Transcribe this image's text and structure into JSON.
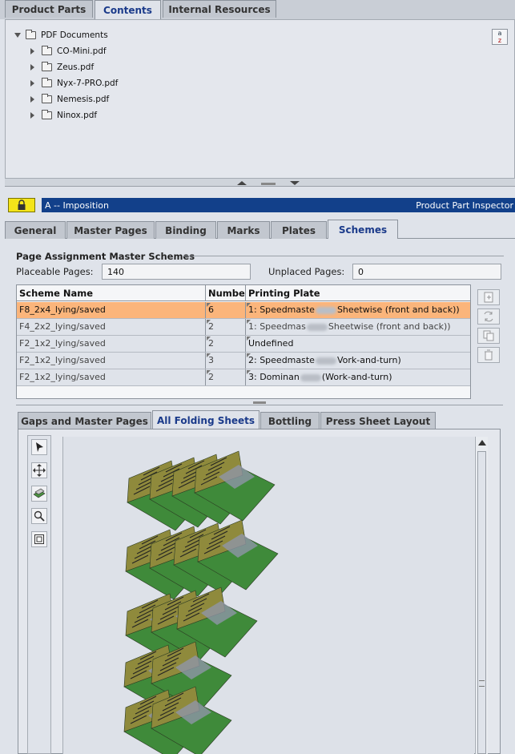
{
  "top_tabs": [
    {
      "label": "Product Parts",
      "active": false
    },
    {
      "label": "Contents",
      "active": true
    },
    {
      "label": "Internal Resources",
      "active": false
    }
  ],
  "tree": {
    "root": "PDF Documents",
    "items": [
      "CO-Mini.pdf",
      "Zeus.pdf",
      "Nyx-7-PRO.pdf",
      "Nemesis.pdf",
      "Ninox.pdf"
    ]
  },
  "sort_icon_text": {
    "top": "a",
    "bottom": "z"
  },
  "inspector": {
    "title": "A -- Imposition",
    "right_title": "Product Part Inspector"
  },
  "inspector_tabs": [
    {
      "label": "General",
      "active": false
    },
    {
      "label": "Master Pages",
      "active": false
    },
    {
      "label": "Binding",
      "active": false
    },
    {
      "label": "Marks",
      "active": false
    },
    {
      "label": "Plates",
      "active": false
    },
    {
      "label": "Schemes",
      "active": true
    }
  ],
  "page_assignment": {
    "group_title": "Page Assignment  Master Schemes",
    "placeable_label": "Placeable Pages:",
    "placeable_value": "140",
    "unplaced_label": "Unplaced Pages:",
    "unplaced_value": "0"
  },
  "scheme_table": {
    "columns": [
      "Scheme Name",
      "Number",
      "Printing Plate"
    ],
    "rows": [
      {
        "name": "F8_2x4_lying/saved",
        "number": "6",
        "plate_a": "1: Speedmaste",
        "plate_b": "Sheetwise (front and back))",
        "selected": true
      },
      {
        "name": "F4_2x2_lying/saved",
        "number": "2",
        "plate_a": "1: Speedmas",
        "plate_b": "Sheetwise (front and back))",
        "selected": false
      },
      {
        "name": "F2_1x2_lying/saved",
        "number": "2",
        "plate_a": "Undefined",
        "plate_b": "",
        "selected": false
      },
      {
        "name": "F2_1x2_lying/saved",
        "number": "3",
        "plate_a": "2: Speedmaste",
        "plate_b": "Vork-and-turn)",
        "selected": false
      },
      {
        "name": "F2_1x2_lying/saved",
        "number": "2",
        "plate_a": "3: Dominan",
        "plate_b": "(Work-and-turn)",
        "selected": false
      }
    ]
  },
  "lower_tabs": [
    {
      "label": "Gaps and Master Pages",
      "active": false
    },
    {
      "label": "All Folding Sheets",
      "active": true
    },
    {
      "label": "Bottling",
      "active": false
    },
    {
      "label": "Press Sheet Layout",
      "active": false
    }
  ],
  "colors": {
    "titlebar": "#12408a",
    "selected_row": "#fbb57b",
    "lock": "#f4e41a",
    "sheet_face": "#8f8a3c",
    "sheet_back": "#3f8a3a"
  }
}
